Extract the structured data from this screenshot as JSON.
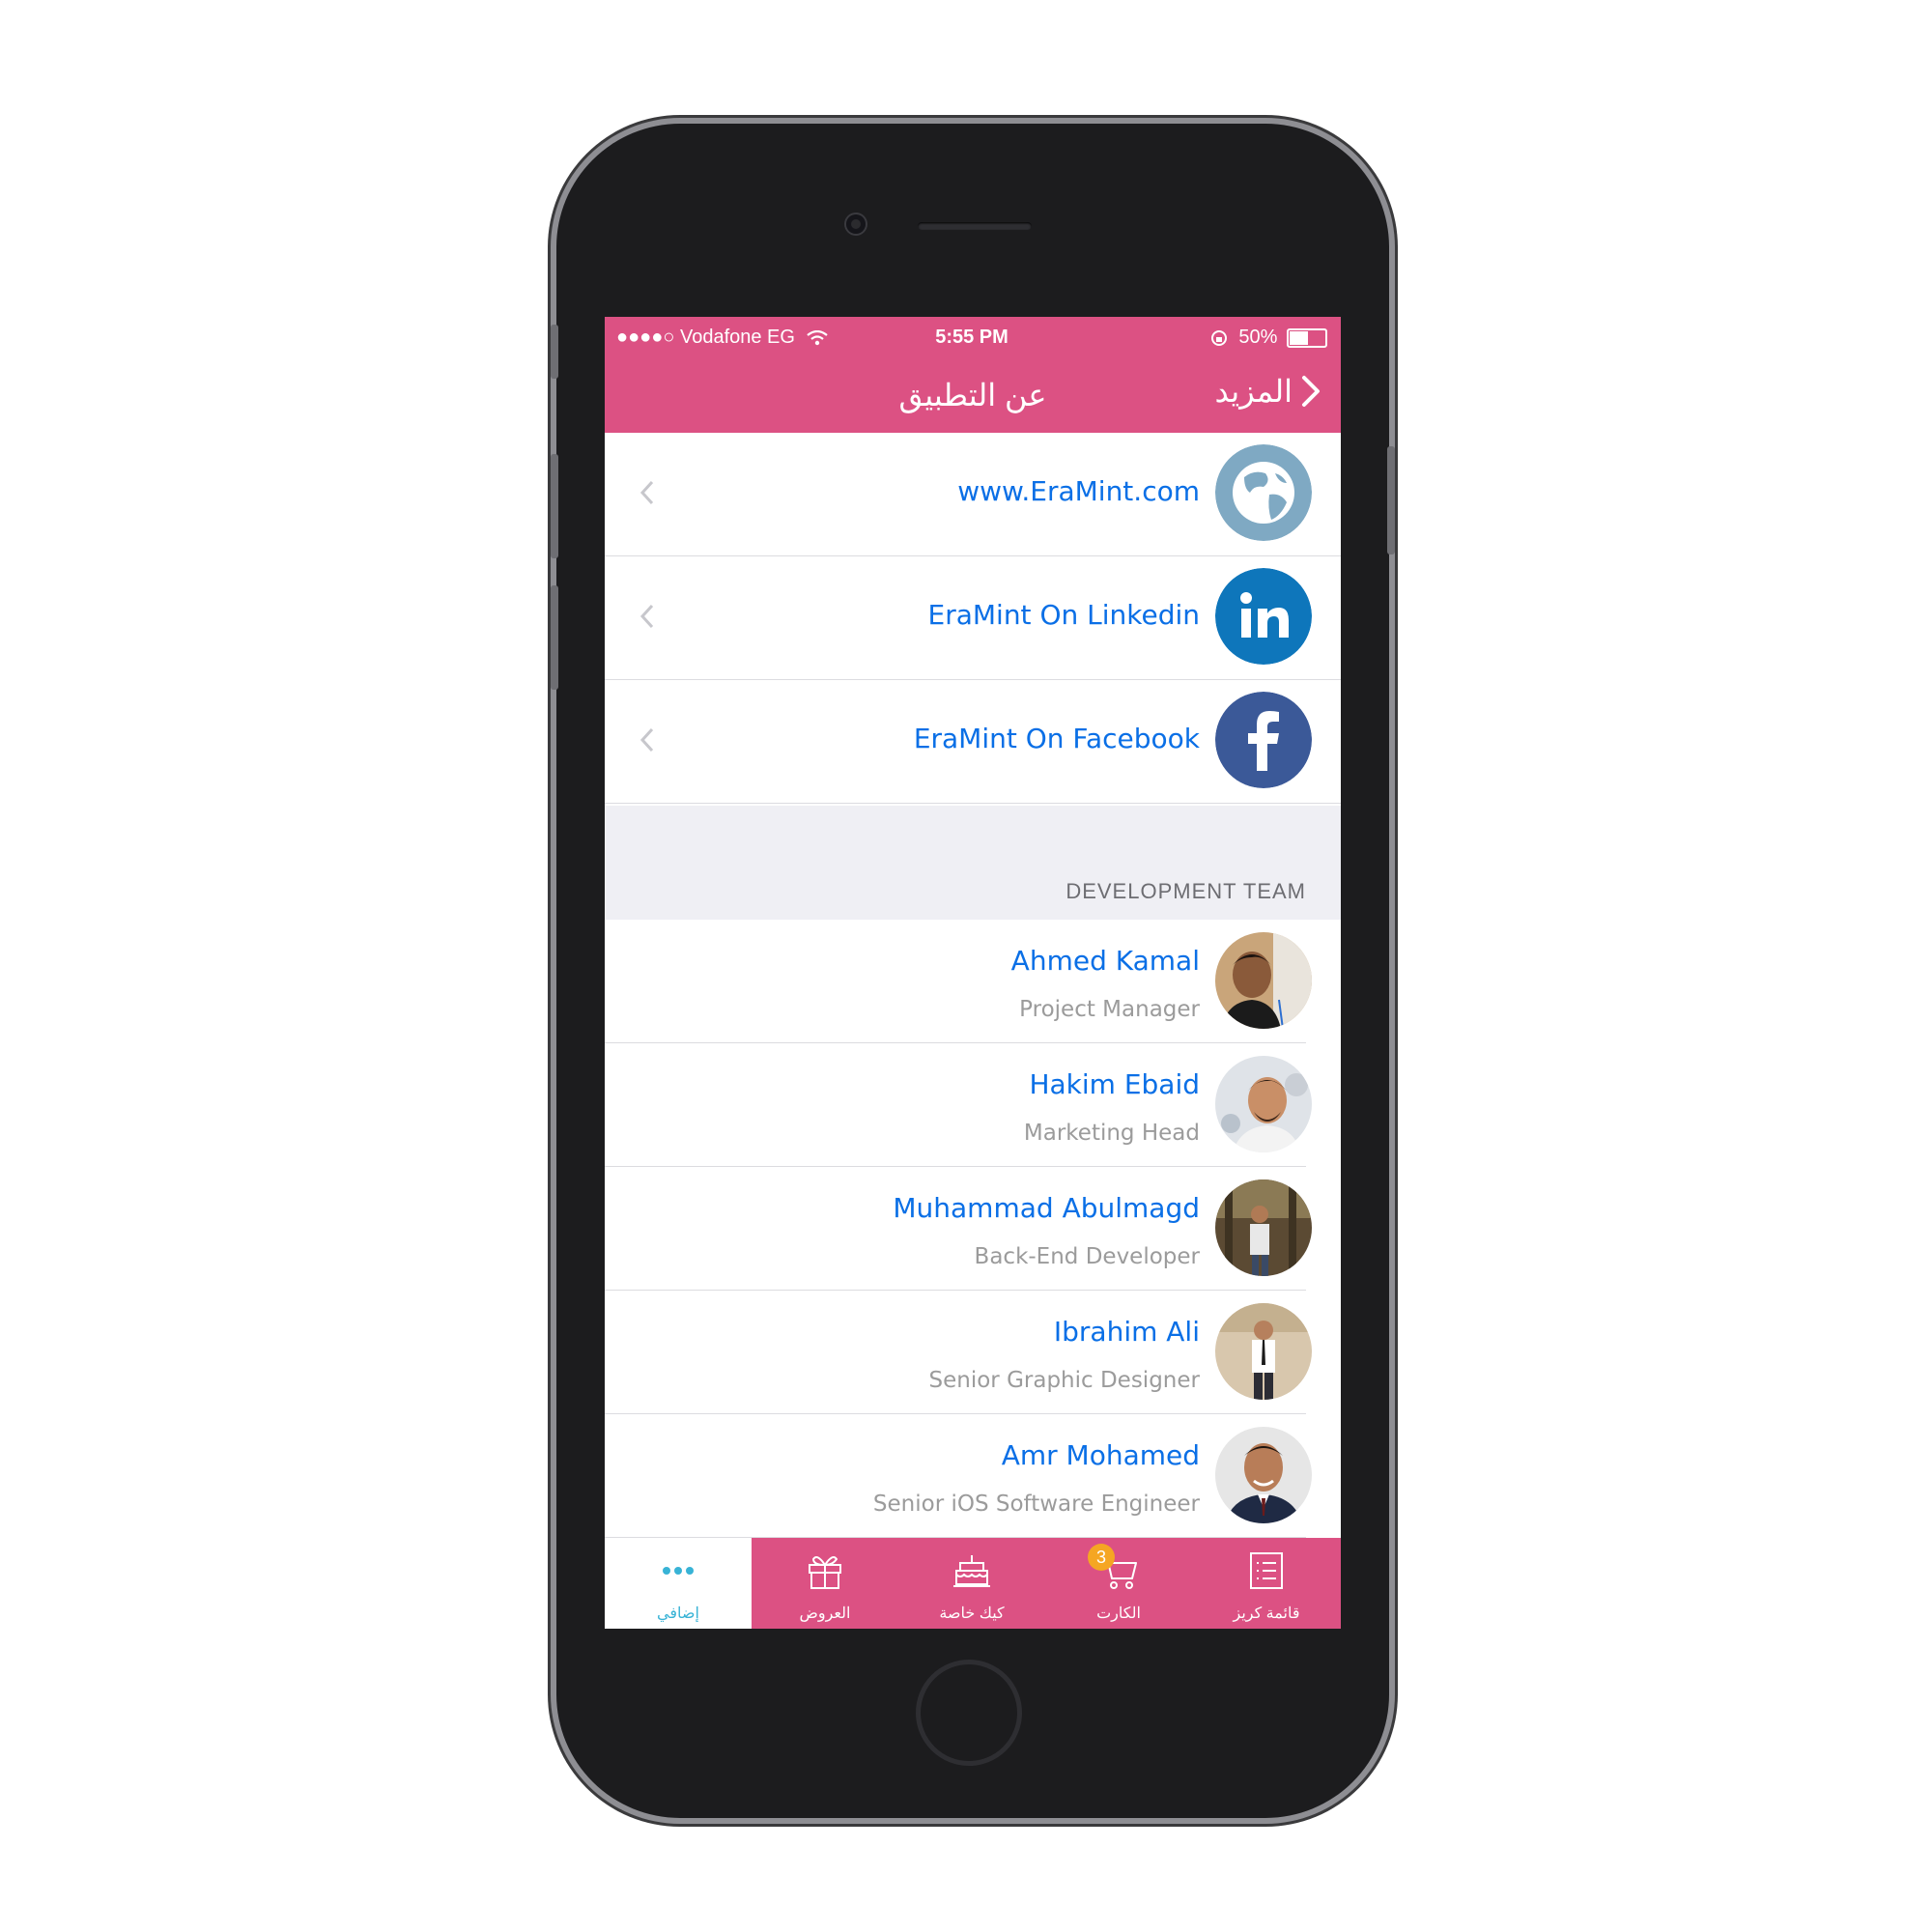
{
  "status_bar": {
    "carrier": "●●●●○ Vodafone EG",
    "time": "5:55 PM",
    "battery": "50%"
  },
  "nav": {
    "title": "عن التطبيق",
    "back_label": "المزيد"
  },
  "links": [
    {
      "label": "www.EraMint.com",
      "icon": "globe-icon",
      "color": "#7fa9c3"
    },
    {
      "label": "EraMint On Linkedin",
      "icon": "linkedin-icon",
      "color": "#0e76bb"
    },
    {
      "label": "EraMint On Facebook",
      "icon": "facebook-icon",
      "color": "#3b5998"
    }
  ],
  "team": {
    "section_title": "DEVELOPMENT TEAM",
    "members": [
      {
        "name": "Ahmed Kamal",
        "role": "Project Manager"
      },
      {
        "name": "Hakim Ebaid",
        "role": "Marketing Head"
      },
      {
        "name": "Muhammad Abulmagd",
        "role": "Back-End  Developer"
      },
      {
        "name": "Ibrahim Ali",
        "role": "Senior Graphic Designer"
      },
      {
        "name": "Amr Mohamed",
        "role": "Senior iOS Software Engineer"
      }
    ]
  },
  "tabs": [
    {
      "label": "إضافي",
      "icon": "more-dots-icon",
      "active": true
    },
    {
      "label": "العروض",
      "icon": "gift-icon"
    },
    {
      "label": "كيك خاصة",
      "icon": "cake-icon"
    },
    {
      "label": "الكارت",
      "icon": "cart-icon",
      "badge": "3"
    },
    {
      "label": "قائمة كريز",
      "icon": "list-icon"
    }
  ],
  "colors": {
    "brand": "#dc5183",
    "link": "#0a6fe6",
    "active_tab": "#38b3d6",
    "badge": "#f5a623"
  }
}
